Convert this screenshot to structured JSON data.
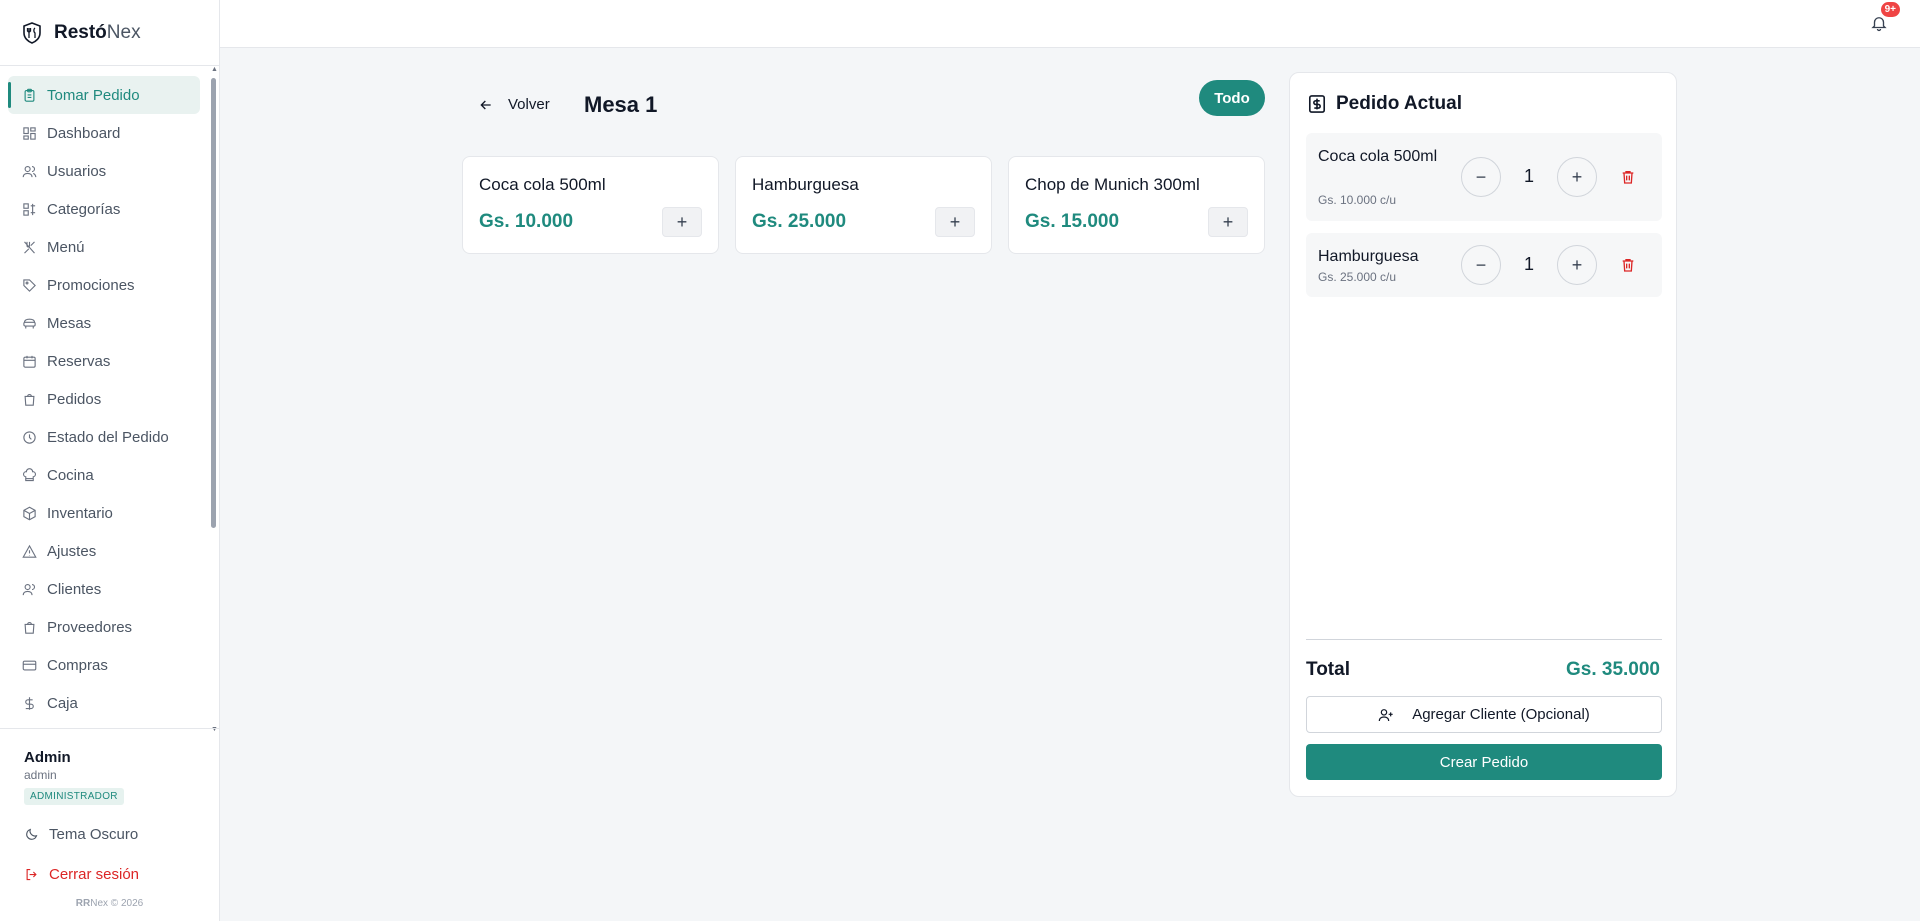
{
  "brand": {
    "name_bold": "Restó",
    "name_light": "Nex"
  },
  "nav": {
    "items": [
      {
        "label": "Tomar Pedido",
        "icon": "clipboard-icon",
        "active": true
      },
      {
        "label": "Dashboard",
        "icon": "dashboard-icon"
      },
      {
        "label": "Usuarios",
        "icon": "users-icon"
      },
      {
        "label": "Categorías",
        "icon": "categories-icon"
      },
      {
        "label": "Menú",
        "icon": "utensils-icon"
      },
      {
        "label": "Promociones",
        "icon": "tag-icon"
      },
      {
        "label": "Mesas",
        "icon": "table-icon"
      },
      {
        "label": "Reservas",
        "icon": "calendar-icon"
      },
      {
        "label": "Pedidos",
        "icon": "bag-icon"
      },
      {
        "label": "Estado del Pedido",
        "icon": "clock-icon"
      },
      {
        "label": "Cocina",
        "icon": "chef-hat-icon"
      },
      {
        "label": "Inventario",
        "icon": "box-icon"
      },
      {
        "label": "Ajustes",
        "icon": "warning-icon"
      },
      {
        "label": "Clientes",
        "icon": "clients-icon"
      },
      {
        "label": "Proveedores",
        "icon": "supplier-icon"
      },
      {
        "label": "Compras",
        "icon": "card-icon"
      },
      {
        "label": "Caja",
        "icon": "dollar-icon"
      }
    ]
  },
  "user": {
    "name": "Admin",
    "handle": "admin",
    "role": "ADMINISTRADOR"
  },
  "actions": {
    "theme": "Tema Oscuro",
    "logout": "Cerrar sesión"
  },
  "copyright": {
    "brand": "RR",
    "text": "Nex © 2026"
  },
  "notifications": {
    "badge": "9+"
  },
  "main": {
    "back_label": "Volver",
    "table_title": "Mesa 1",
    "filter_label": "Todo",
    "products": [
      {
        "name": "Coca cola 500ml",
        "price": "Gs. 10.000"
      },
      {
        "name": "Hamburguesa",
        "price": "Gs. 25.000"
      },
      {
        "name": "Chop de Munich 300ml",
        "price": "Gs. 15.000"
      }
    ]
  },
  "order": {
    "title": "Pedido Actual",
    "items": [
      {
        "name": "Coca cola 500ml",
        "unit_price": "Gs. 10.000 c/u",
        "qty": "1"
      },
      {
        "name": "Hamburguesa",
        "unit_price": "Gs. 25.000 c/u",
        "qty": "1"
      }
    ],
    "total_label": "Total",
    "total_value": "Gs. 35.000",
    "add_client_label": "Agregar Cliente (Opcional)",
    "create_label": "Crear Pedido"
  },
  "colors": {
    "accent": "#1f8a7e",
    "danger": "#dc2626"
  }
}
